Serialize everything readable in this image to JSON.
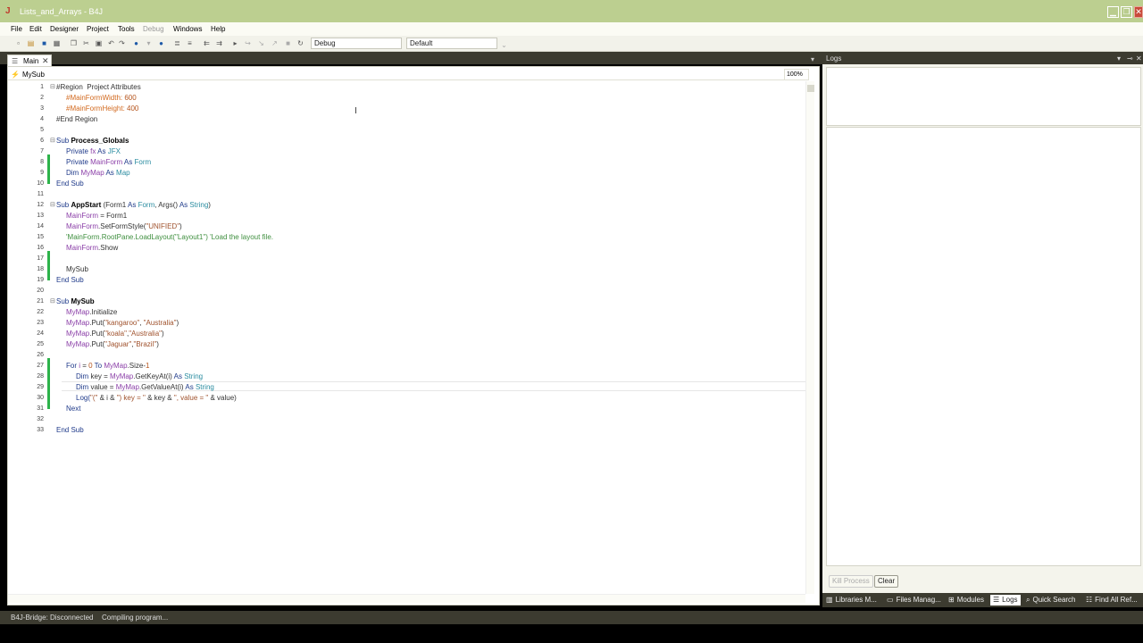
{
  "window": {
    "title": "Lists_and_Arrays - B4J",
    "min_glyph": "▁",
    "max_glyph": "❐",
    "close_glyph": "✕"
  },
  "menu": [
    "File",
    "Edit",
    "Designer",
    "Project",
    "Tools",
    "Debug",
    "Windows",
    "Help"
  ],
  "toolbar": {
    "build_config": "Debug",
    "target": "Default"
  },
  "editor": {
    "tab_label": "Main",
    "tab_close": "✕",
    "sub_dropdown": "MySub",
    "zoom": "100%"
  },
  "code_lines": [
    {
      "n": "1"
    },
    {
      "n": "2"
    },
    {
      "n": "3"
    },
    {
      "n": "4"
    },
    {
      "n": "5"
    },
    {
      "n": "6"
    },
    {
      "n": "7"
    },
    {
      "n": "8"
    },
    {
      "n": "9"
    },
    {
      "n": "10"
    },
    {
      "n": "11"
    },
    {
      "n": "12"
    },
    {
      "n": "13"
    },
    {
      "n": "14"
    },
    {
      "n": "15"
    },
    {
      "n": "16"
    },
    {
      "n": "17"
    },
    {
      "n": "18"
    },
    {
      "n": "19"
    },
    {
      "n": "20"
    },
    {
      "n": "21"
    },
    {
      "n": "22"
    },
    {
      "n": "23"
    },
    {
      "n": "24"
    },
    {
      "n": "25"
    },
    {
      "n": "26"
    },
    {
      "n": "27"
    },
    {
      "n": "28"
    },
    {
      "n": "29"
    },
    {
      "n": "30"
    },
    {
      "n": "31"
    },
    {
      "n": "32"
    },
    {
      "n": "33"
    }
  ],
  "code": {
    "l1": "#Region  Project Attributes",
    "l2a": "#MainFormWidth: ",
    "l2b": "600",
    "l3a": "#MainFormHeight: ",
    "l3b": "400",
    "l4": "#End Region",
    "l6a": "Sub ",
    "l6b": "Process_Globals",
    "l7a": "Private ",
    "l7b": "fx",
    "l7c": " As ",
    "l7d": "JFX",
    "l8a": "Private ",
    "l8b": "MainForm",
    "l8c": " As ",
    "l8d": "Form",
    "l9a": "Dim ",
    "l9b": "MyMap",
    "l9c": " As ",
    "l9d": "Map",
    "l10": "End Sub",
    "l12a": "Sub ",
    "l12b": "AppStart",
    "l12c": " (Form1 ",
    "l12d": "As ",
    "l12e": "Form",
    "l12f": ", Args() ",
    "l12g": "As ",
    "l12h": "String",
    "l12i": ")",
    "l13a": "MainForm",
    "l13b": " = Form1",
    "l14a": "MainForm",
    "l14b": ".SetFormStyle(",
    "l14c": "\"UNIFIED\"",
    "l14d": ")",
    "l15": "'MainForm.RootPane.LoadLayout(\"Layout1\") 'Load the layout file.",
    "l16a": "MainForm",
    "l16b": ".Show",
    "l18": "MySub",
    "l19": "End Sub",
    "l21a": "Sub ",
    "l21b": "MySub",
    "l22a": "MyMap",
    "l22b": ".Initialize",
    "l23a": "MyMap",
    "l23b": ".Put(",
    "l23c": "\"kangaroo\"",
    "l23d": ", ",
    "l23e": "\"Australia\"",
    "l23f": ")",
    "l24a": "MyMap",
    "l24b": ".Put(",
    "l24c": "\"koala\"",
    "l24d": ",",
    "l24e": "\"Australia\"",
    "l24f": ")",
    "l25a": "MyMap",
    "l25b": ".Put(",
    "l25c": "\"Jaguar\"",
    "l25d": ",",
    "l25e": "\"Brazil\"",
    "l25f": ")",
    "l27a": "For ",
    "l27b": "i",
    "l27c": " = ",
    "l27d": "0",
    "l27e": " To ",
    "l27f": "MyMap",
    "l27g": ".Size-",
    "l27h": "1",
    "l28a": "Dim ",
    "l28b": "key = ",
    "l28c": "MyMap",
    "l28d": ".GetKeyAt(i) ",
    "l28e": "As ",
    "l28f": "String",
    "l29a": "Dim ",
    "l29b": "value = ",
    "l29c": "MyMap",
    "l29d": ".GetValueAt(i) ",
    "l29e": "As ",
    "l29f": "String",
    "l30a": "Log(",
    "l30b": "\"(\"",
    "l30c": " & i & ",
    "l30d": "\") key = \"",
    "l30e": " & key & ",
    "l30f": "\", value = \"",
    "l30g": " & value)",
    "l31": "Next",
    "l33": "End Sub"
  },
  "logs": {
    "title": "Logs",
    "kill_label": "Kill Process",
    "clear_label": "Clear"
  },
  "bottom_tabs": [
    "Libraries M...",
    "Files Manag...",
    "Modules",
    "Logs",
    "Quick Search",
    "Find All Ref..."
  ],
  "status": {
    "bridge": "B4J-Bridge: Disconnected",
    "message": "Compiling program..."
  }
}
